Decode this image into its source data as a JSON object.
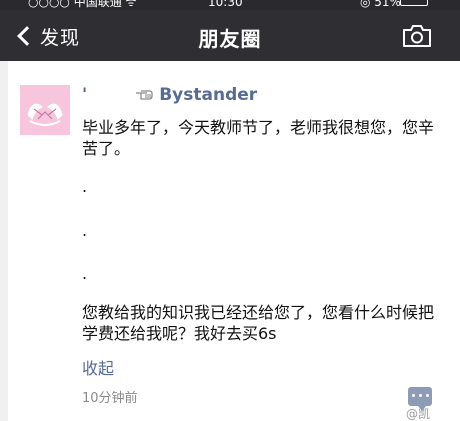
{
  "status_bar": {
    "carrier": "○○○○ 中国联通 ᯤ",
    "time": "10:30",
    "battery": "◎ 51%"
  },
  "nav": {
    "back_label": "发现",
    "title": "朋友圈",
    "back_icon": "chevron-left-icon",
    "camera_icon": "camera-icon"
  },
  "post": {
    "name_prefix": "'",
    "name": "Bystander",
    "pointer_icon": "pointing-hand-icon",
    "text_1": "毕业多年了，今天教师节了，老师我很想您，您辛苦了。",
    "dots": [
      ".",
      ".",
      "."
    ],
    "text_2": "您教给我的知识我已经还给您了，您看什么时候把学费还给我呢？我好去买6s",
    "collapse": "收起",
    "time": "10分钟前",
    "comment_icon": "comment-icon"
  },
  "watermark": "@凯"
}
